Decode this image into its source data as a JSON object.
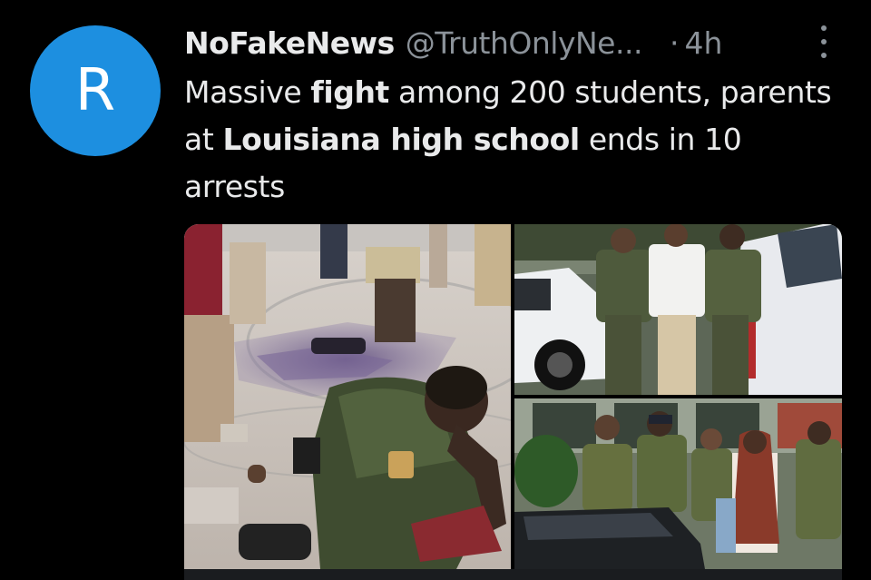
{
  "avatar": {
    "letter": "R",
    "color": "#1d8fe0"
  },
  "author": {
    "display_name": "NoFakeNews",
    "handle": "@TruthOnlyNe...",
    "separator": "·",
    "time": "4h"
  },
  "menu": {
    "icon": "more-vertical-icon"
  },
  "tweet": {
    "segments": [
      {
        "text": "Massive ",
        "bold": false
      },
      {
        "text": "fight",
        "bold": true
      },
      {
        "text": " among 200 students, parents at ",
        "bold": false
      },
      {
        "text": "Louisiana high school",
        "bold": true
      },
      {
        "text": " ends in 10 arrests",
        "bold": false
      }
    ]
  },
  "media": {
    "images": [
      {
        "name": "photo-gym-arrest",
        "subject": "officer restraining person on gym floor"
      },
      {
        "name": "photo-officers-escort",
        "subject": "officers escorting young man by police car"
      },
      {
        "name": "photo-crowd-deputies",
        "subject": "deputies and crowd outside school"
      }
    ]
  },
  "colors": {
    "background": "#000000",
    "text_primary": "#e9eaeb",
    "text_secondary": "#8b9299",
    "accent": "#1d8fe0"
  }
}
